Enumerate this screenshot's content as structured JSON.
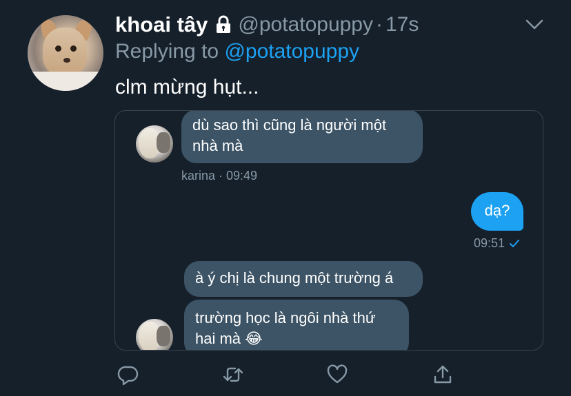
{
  "tweet": {
    "display_name": "khoai tây",
    "handle": "@potatopuppy",
    "separator": "·",
    "time": "17s",
    "replying_prefix": "Replying to ",
    "replying_handle": "@potatopuppy",
    "text": "clm mừng hụt..."
  },
  "chat": {
    "messages": [
      {
        "sender": "karina",
        "text": "dù sao thì cũng là người một nhà mà"
      },
      {
        "sender": "me",
        "text": "dạ?"
      },
      {
        "sender": "karina",
        "text": "à ý chị là chung một trường á"
      },
      {
        "sender": "karina",
        "text": "trường học là ngôi nhà thứ hai mà 😂"
      }
    ],
    "meta_karina": "karina · 09:49",
    "meta_me": "09:51"
  },
  "icons": {
    "lock": "lock-icon",
    "chevron": "chevron-down-icon",
    "reply": "reply-icon",
    "retweet": "retweet-icon",
    "like": "heart-icon",
    "share": "share-icon",
    "read": "check-icon"
  },
  "colors": {
    "background": "#15202b",
    "accent": "#1da1f2",
    "muted": "#8899a6",
    "bubble": "#3d5466",
    "border": "#38444d"
  }
}
